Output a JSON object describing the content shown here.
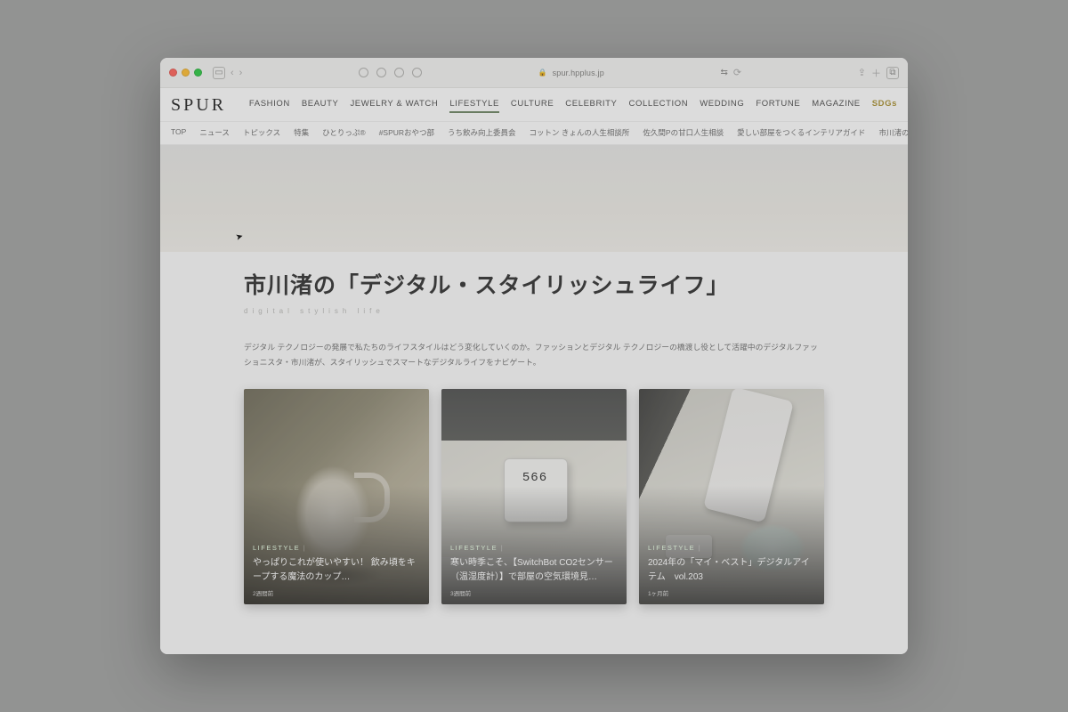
{
  "browser": {
    "url": "spur.hpplus.jp"
  },
  "logo": "SPUR",
  "nav1": [
    "FASHION",
    "BEAUTY",
    "JEWELRY & WATCH",
    "LIFESTYLE",
    "CULTURE",
    "CELEBRITY",
    "COLLECTION",
    "WEDDING",
    "FORTUNE",
    "MAGAZINE",
    "SDGs"
  ],
  "nav1_active_index": 3,
  "nav2": [
    "TOP",
    "ニュース",
    "トピックス",
    "特集",
    "ひとりっぷ®",
    "#SPURおやつ部",
    "うち飲み向上委員会",
    "コットン きょんの人生相談所",
    "佐久間Pの甘口人生相談",
    "愛しい部屋をつくるインテリアガイド",
    "市川渚の「デジタル"
  ],
  "page": {
    "title": "市川渚の「デジタル・スタイリッシュライフ」",
    "subtitle": "digital stylish life",
    "lead": "デジタル テクノロジーの発展で私たちのライフスタイルはどう変化していくのか。ファッションとデジタル テクノロジーの橋渡し役として活躍中のデジタルファッショニスタ・市川渚が、スタイリッシュでスマートなデジタルライフをナビゲート。"
  },
  "cards": [
    {
      "category": "LIFESTYLE",
      "title": "やっぱりこれが使いやすい！ 飲み頃をキープする魔法のカップ…",
      "time": "2週間前"
    },
    {
      "category": "LIFESTYLE",
      "title": "寒い時季こそ、【SwitchBot CO2センサー（温湿度計）】で部屋の空気環境見…",
      "time": "3週間前"
    },
    {
      "category": "LIFESTYLE",
      "title": "2024年の「マイ・ベスト」デジタルアイテム　vol.203",
      "time": "1ヶ月前"
    }
  ]
}
